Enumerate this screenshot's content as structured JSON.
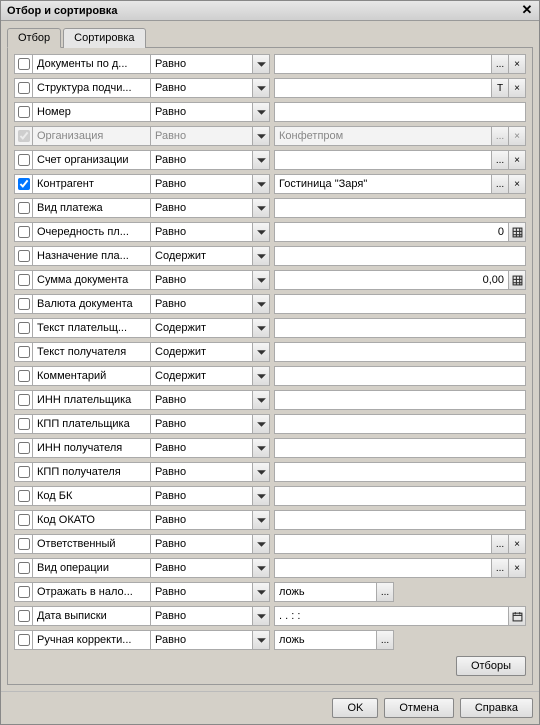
{
  "window": {
    "title": "Отбор и сортировка"
  },
  "tabs": {
    "active": "Отбор",
    "other": "Сортировка"
  },
  "ops": {
    "equal": "Равно",
    "contains": "Содержит"
  },
  "rows": [
    {
      "id": "docs",
      "label": "Документы по д...",
      "op": "equal",
      "checked": false,
      "value": "",
      "btns": [
        "dots",
        "x"
      ]
    },
    {
      "id": "struct",
      "label": "Структура подчи...",
      "op": "equal",
      "checked": false,
      "value": "",
      "btns": [
        "T",
        "x"
      ]
    },
    {
      "id": "number",
      "label": "Номер",
      "op": "equal",
      "checked": false,
      "value": "",
      "btns": []
    },
    {
      "id": "org",
      "label": "Организация",
      "op": "equal",
      "checked": true,
      "value": "Конфетпром",
      "btns": [
        "dots",
        "x"
      ],
      "disabled": true
    },
    {
      "id": "account",
      "label": "Счет организации",
      "op": "equal",
      "checked": false,
      "value": "",
      "btns": [
        "dots",
        "x"
      ]
    },
    {
      "id": "counter",
      "label": "Контрагент",
      "op": "equal",
      "checked": true,
      "value": "Гостиница \"Заря\"",
      "btns": [
        "dots",
        "x"
      ]
    },
    {
      "id": "paytype",
      "label": "Вид платежа",
      "op": "equal",
      "checked": false,
      "value": "",
      "btns": []
    },
    {
      "id": "priority",
      "label": "Очередность пл...",
      "op": "equal",
      "checked": false,
      "value": "0",
      "btns": [
        "calc"
      ],
      "align": "right"
    },
    {
      "id": "purpose",
      "label": "Назначение пла...",
      "op": "contains",
      "checked": false,
      "value": "|",
      "btns": [],
      "editing": true
    },
    {
      "id": "sum",
      "label": "Сумма документа",
      "op": "equal",
      "checked": false,
      "value": "0,00",
      "btns": [
        "calc"
      ],
      "align": "right"
    },
    {
      "id": "currency",
      "label": "Валюта документа",
      "op": "equal",
      "checked": false,
      "value": "",
      "btns": []
    },
    {
      "id": "payertext",
      "label": "Текст плательщ...",
      "op": "contains",
      "checked": false,
      "value": "",
      "btns": []
    },
    {
      "id": "rectext",
      "label": "Текст получателя",
      "op": "contains",
      "checked": false,
      "value": "",
      "btns": []
    },
    {
      "id": "comment",
      "label": "Комментарий",
      "op": "contains",
      "checked": false,
      "value": "",
      "btns": []
    },
    {
      "id": "payerinn",
      "label": "ИНН плательщика",
      "op": "equal",
      "checked": false,
      "value": "",
      "btns": []
    },
    {
      "id": "payerkpp",
      "label": "КПП плательщика",
      "op": "equal",
      "checked": false,
      "value": "",
      "btns": []
    },
    {
      "id": "recinn",
      "label": "ИНН получателя",
      "op": "equal",
      "checked": false,
      "value": "",
      "btns": []
    },
    {
      "id": "reckpp",
      "label": "КПП получателя",
      "op": "equal",
      "checked": false,
      "value": "",
      "btns": []
    },
    {
      "id": "bk",
      "label": "Код БК",
      "op": "equal",
      "checked": false,
      "value": "",
      "btns": []
    },
    {
      "id": "okato",
      "label": "Код ОКАТО",
      "op": "equal",
      "checked": false,
      "value": "",
      "btns": []
    },
    {
      "id": "resp",
      "label": "Ответственный",
      "op": "equal",
      "checked": false,
      "value": "",
      "btns": [
        "dots",
        "x"
      ]
    },
    {
      "id": "optype",
      "label": "Вид операции",
      "op": "equal",
      "checked": false,
      "value": "",
      "btns": [
        "dots",
        "x"
      ]
    },
    {
      "id": "tax",
      "label": "Отражать в нало...",
      "op": "equal",
      "checked": false,
      "value": "ложь",
      "btns": [
        "dots"
      ],
      "short": true
    },
    {
      "id": "date",
      "label": "Дата выписки",
      "op": "equal",
      "checked": false,
      "value": "  .  .       :  :",
      "btns": [
        "cal"
      ]
    },
    {
      "id": "manual",
      "label": "Ручная корректи...",
      "op": "equal",
      "checked": false,
      "value": "ложь",
      "btns": [
        "dots"
      ],
      "short": true
    }
  ],
  "buttons": {
    "filters": "Отборы",
    "ok": "OK",
    "cancel": "Отмена",
    "help": "Справка"
  },
  "icons": {
    "dots": "...",
    "x": "×",
    "T": "T",
    "dropdown": "▼",
    "calc": "▦",
    "cal": "📅"
  }
}
